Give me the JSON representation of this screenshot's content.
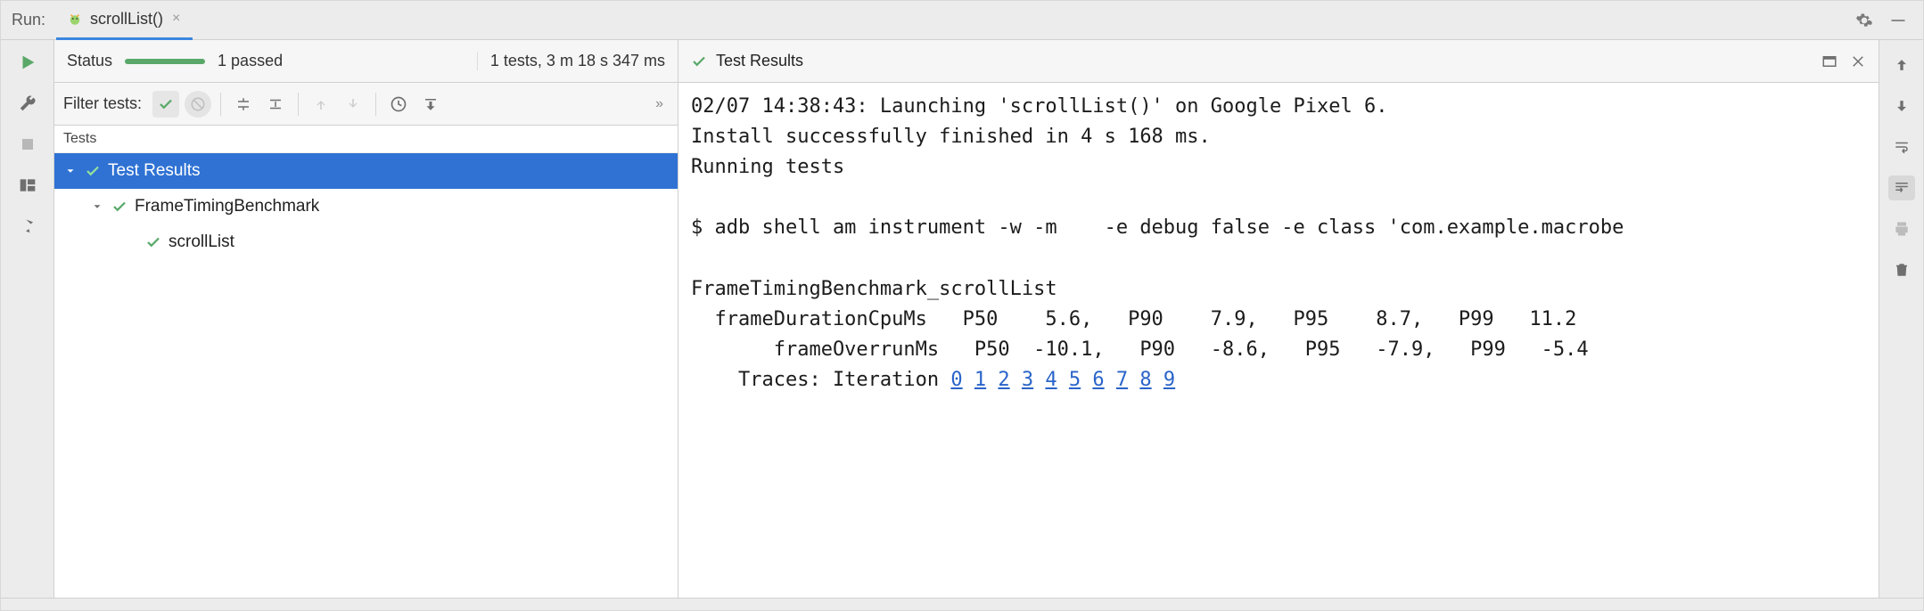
{
  "header": {
    "run_label": "Run:",
    "tab_title": "scrollList()"
  },
  "status": {
    "label": "Status",
    "passed": "1 passed",
    "summary": "1 tests, 3 m 18 s 347 ms"
  },
  "filter": {
    "label": "Filter tests:"
  },
  "tree": {
    "header": "Tests",
    "root": "Test Results",
    "suite": "FrameTimingBenchmark",
    "test": "scrollList"
  },
  "console": {
    "header": "Test Results",
    "lines": {
      "l1": "02/07 14:38:43: Launching 'scrollList()' on Google Pixel 6.",
      "l2": "Install successfully finished in 4 s 168 ms.",
      "l3": "Running tests",
      "l4": "",
      "l5": "$ adb shell am instrument -w -m    -e debug false -e class 'com.example.macrobe",
      "l6": "",
      "l7": "FrameTimingBenchmark_scrollList",
      "l8": "  frameDurationCpuMs   P50    5.6,   P90    7.9,   P95    8.7,   P99   11.2",
      "l9": "       frameOverrunMs   P50  -10.1,   P90   -8.6,   P95   -7.9,   P99   -5.4",
      "trace_prefix": "    Traces: Iteration ",
      "trace_links": [
        "0",
        "1",
        "2",
        "3",
        "4",
        "5",
        "6",
        "7",
        "8",
        "9"
      ]
    }
  }
}
